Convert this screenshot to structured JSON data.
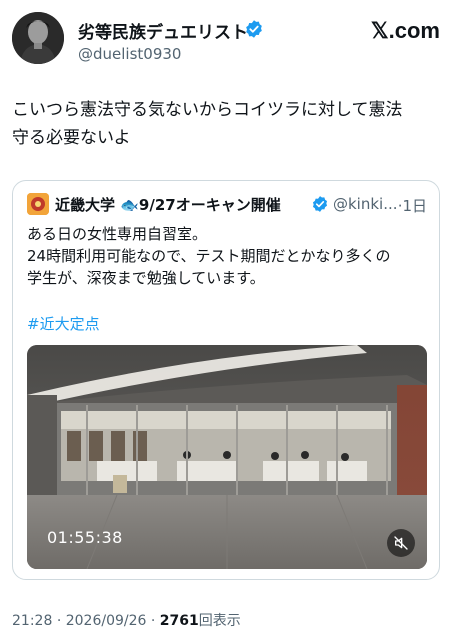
{
  "author": {
    "display_name": "劣等民族デュエリスト",
    "handle": "@duelist0930"
  },
  "brand": "𝕏.com",
  "tweet": {
    "text_line1": "こいつら憲法守る気ないからコイツラに対して憲法",
    "text_line2": "守る必要ないよ"
  },
  "quoted": {
    "name": "近畿大学 🐟9/27オーキャン開催",
    "handle": "@kinki...",
    "time": "·1日",
    "body_line1": "ある日の女性専用自習室。",
    "body_line2": "24時間利用可能なので、テスト期間だとかなり多くの",
    "body_line3": "学生が、深夜まで勉強しています。",
    "hashtag": "#近大定点",
    "video": {
      "duration": "01:55:38",
      "mute_icon": "muted-speaker-icon"
    }
  },
  "meta": {
    "time": "21:28",
    "date": "2026/09/26",
    "views_count": "2761",
    "views_label": "回表示",
    "sep": "·"
  },
  "colors": {
    "verified_blue": "#1d9bf0",
    "link_blue": "#1d9bf0",
    "muted_gray": "#536471",
    "border": "#cfd9de"
  }
}
